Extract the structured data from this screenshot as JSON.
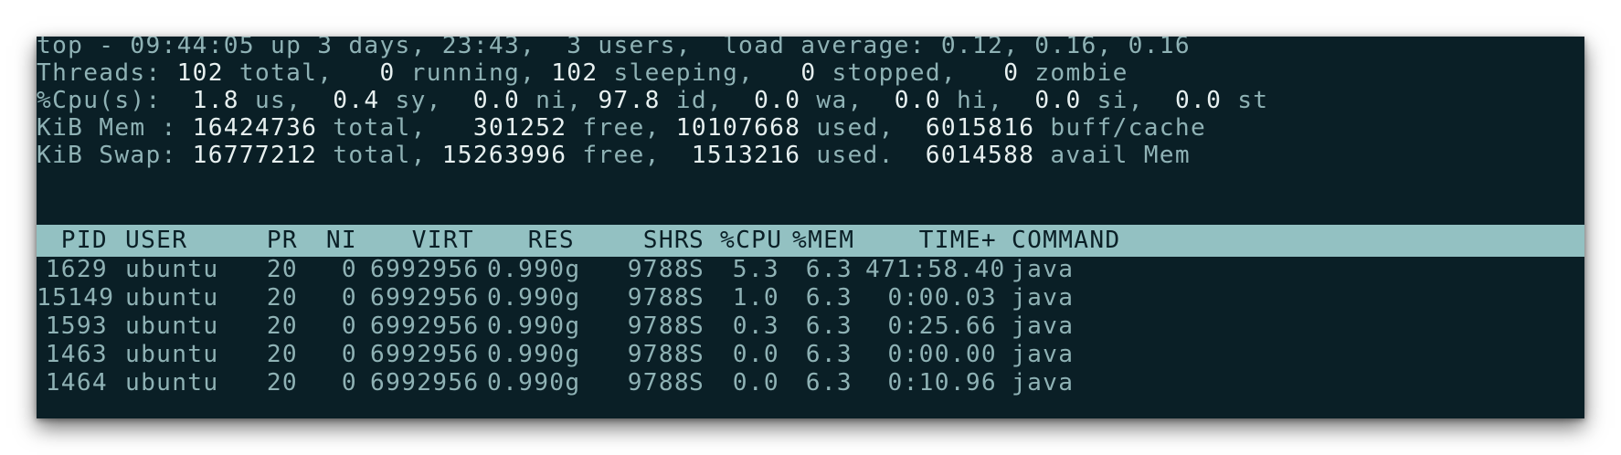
{
  "summary": {
    "top": {
      "prefix": "top - ",
      "time": "09:44:05",
      "uptime": " up 3 days, 23:43,",
      "users": "  3 users,",
      "load_label": "  load average: ",
      "load": "0.12, 0.16, 0.16"
    },
    "threads": {
      "label": "Threads: ",
      "total": "102",
      "total_label": " total,   ",
      "running": "0",
      "running_label": " running, ",
      "sleeping": "102",
      "sleeping_label": " sleeping,   ",
      "stopped": "0",
      "stopped_label": " stopped,   ",
      "zombie": "0",
      "zombie_label": " zombie"
    },
    "cpu": {
      "label": "%Cpu(s):  ",
      "us": "1.8",
      "us_label": " us,  ",
      "sy": "0.4",
      "sy_label": " sy,  ",
      "ni": "0.0",
      "ni_label": " ni, ",
      "id": "97.8",
      "id_label": " id,  ",
      "wa": "0.0",
      "wa_label": " wa,  ",
      "hi": "0.0",
      "hi_label": " hi,  ",
      "si": "0.0",
      "si_label": " si,  ",
      "st": "0.0",
      "st_label": " st"
    },
    "mem": {
      "label": "KiB Mem : ",
      "total": "16424736",
      "total_label": " total,   ",
      "free": "301252",
      "free_label": " free, ",
      "used": "10107668",
      "used_label": " used,  ",
      "buff": "6015816",
      "buff_label": " buff/cache"
    },
    "swap": {
      "label": "KiB Swap: ",
      "total": "16777212",
      "total_label": " total, ",
      "free": "15263996",
      "free_label": " free,  ",
      "used": "1513216",
      "used_label": " used.  ",
      "avail": "6014588",
      "avail_label": " avail Mem"
    }
  },
  "columns": [
    "PID",
    "USER",
    "PR",
    "NI",
    "VIRT",
    "RES",
    "SHR",
    "S",
    "%CPU",
    "%MEM",
    "TIME+",
    "COMMAND"
  ],
  "processes": [
    {
      "pid": "1629",
      "user": "ubuntu",
      "pr": "20",
      "ni": "0",
      "virt": "6992956",
      "res": "0.990g",
      "shr": "9788",
      "s": "S",
      "cpu": "5.3",
      "mem": "6.3",
      "time": "471:58.40",
      "command": "java"
    },
    {
      "pid": "15149",
      "user": "ubuntu",
      "pr": "20",
      "ni": "0",
      "virt": "6992956",
      "res": "0.990g",
      "shr": "9788",
      "s": "S",
      "cpu": "1.0",
      "mem": "6.3",
      "time": "0:00.03",
      "command": "java"
    },
    {
      "pid": "1593",
      "user": "ubuntu",
      "pr": "20",
      "ni": "0",
      "virt": "6992956",
      "res": "0.990g",
      "shr": "9788",
      "s": "S",
      "cpu": "0.3",
      "mem": "6.3",
      "time": "0:25.66",
      "command": "java"
    },
    {
      "pid": "1463",
      "user": "ubuntu",
      "pr": "20",
      "ni": "0",
      "virt": "6992956",
      "res": "0.990g",
      "shr": "9788",
      "s": "S",
      "cpu": "0.0",
      "mem": "6.3",
      "time": "0:00.00",
      "command": "java"
    },
    {
      "pid": "1464",
      "user": "ubuntu",
      "pr": "20",
      "ni": "0",
      "virt": "6992956",
      "res": "0.990g",
      "shr": "9788",
      "s": "S",
      "cpu": "0.0",
      "mem": "6.3",
      "time": "0:10.96",
      "command": "java"
    }
  ],
  "colors": {
    "background": "#0a1f26",
    "text": "#8fb2b5",
    "bold_value": "#e7f0f0",
    "header_bar": "#93c1c2"
  }
}
